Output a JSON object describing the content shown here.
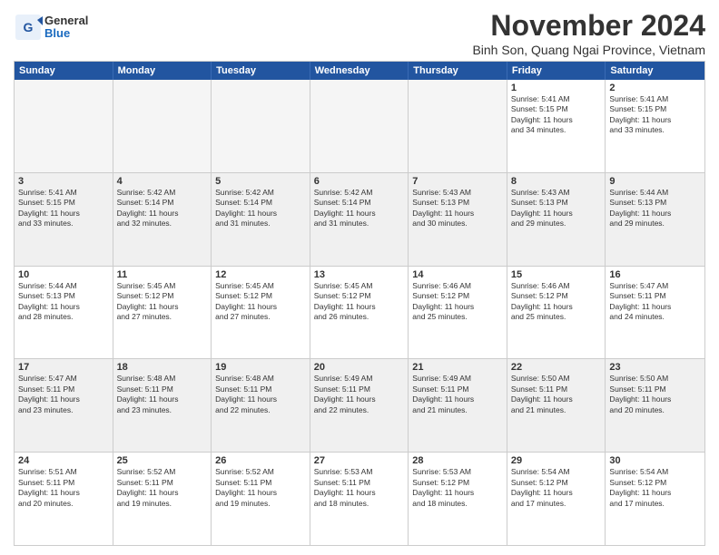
{
  "logo": {
    "general": "General",
    "blue": "Blue"
  },
  "title": "November 2024",
  "location": "Binh Son, Quang Ngai Province, Vietnam",
  "header_days": [
    "Sunday",
    "Monday",
    "Tuesday",
    "Wednesday",
    "Thursday",
    "Friday",
    "Saturday"
  ],
  "weeks": [
    [
      {
        "day": "",
        "info": "",
        "empty": true
      },
      {
        "day": "",
        "info": "",
        "empty": true
      },
      {
        "day": "",
        "info": "",
        "empty": true
      },
      {
        "day": "",
        "info": "",
        "empty": true
      },
      {
        "day": "",
        "info": "",
        "empty": true
      },
      {
        "day": "1",
        "info": "Sunrise: 5:41 AM\nSunset: 5:15 PM\nDaylight: 11 hours\nand 34 minutes.",
        "empty": false
      },
      {
        "day": "2",
        "info": "Sunrise: 5:41 AM\nSunset: 5:15 PM\nDaylight: 11 hours\nand 33 minutes.",
        "empty": false
      }
    ],
    [
      {
        "day": "3",
        "info": "Sunrise: 5:41 AM\nSunset: 5:15 PM\nDaylight: 11 hours\nand 33 minutes.",
        "empty": false
      },
      {
        "day": "4",
        "info": "Sunrise: 5:42 AM\nSunset: 5:14 PM\nDaylight: 11 hours\nand 32 minutes.",
        "empty": false
      },
      {
        "day": "5",
        "info": "Sunrise: 5:42 AM\nSunset: 5:14 PM\nDaylight: 11 hours\nand 31 minutes.",
        "empty": false
      },
      {
        "day": "6",
        "info": "Sunrise: 5:42 AM\nSunset: 5:14 PM\nDaylight: 11 hours\nand 31 minutes.",
        "empty": false
      },
      {
        "day": "7",
        "info": "Sunrise: 5:43 AM\nSunset: 5:13 PM\nDaylight: 11 hours\nand 30 minutes.",
        "empty": false
      },
      {
        "day": "8",
        "info": "Sunrise: 5:43 AM\nSunset: 5:13 PM\nDaylight: 11 hours\nand 29 minutes.",
        "empty": false
      },
      {
        "day": "9",
        "info": "Sunrise: 5:44 AM\nSunset: 5:13 PM\nDaylight: 11 hours\nand 29 minutes.",
        "empty": false
      }
    ],
    [
      {
        "day": "10",
        "info": "Sunrise: 5:44 AM\nSunset: 5:13 PM\nDaylight: 11 hours\nand 28 minutes.",
        "empty": false
      },
      {
        "day": "11",
        "info": "Sunrise: 5:45 AM\nSunset: 5:12 PM\nDaylight: 11 hours\nand 27 minutes.",
        "empty": false
      },
      {
        "day": "12",
        "info": "Sunrise: 5:45 AM\nSunset: 5:12 PM\nDaylight: 11 hours\nand 27 minutes.",
        "empty": false
      },
      {
        "day": "13",
        "info": "Sunrise: 5:45 AM\nSunset: 5:12 PM\nDaylight: 11 hours\nand 26 minutes.",
        "empty": false
      },
      {
        "day": "14",
        "info": "Sunrise: 5:46 AM\nSunset: 5:12 PM\nDaylight: 11 hours\nand 25 minutes.",
        "empty": false
      },
      {
        "day": "15",
        "info": "Sunrise: 5:46 AM\nSunset: 5:12 PM\nDaylight: 11 hours\nand 25 minutes.",
        "empty": false
      },
      {
        "day": "16",
        "info": "Sunrise: 5:47 AM\nSunset: 5:11 PM\nDaylight: 11 hours\nand 24 minutes.",
        "empty": false
      }
    ],
    [
      {
        "day": "17",
        "info": "Sunrise: 5:47 AM\nSunset: 5:11 PM\nDaylight: 11 hours\nand 23 minutes.",
        "empty": false
      },
      {
        "day": "18",
        "info": "Sunrise: 5:48 AM\nSunset: 5:11 PM\nDaylight: 11 hours\nand 23 minutes.",
        "empty": false
      },
      {
        "day": "19",
        "info": "Sunrise: 5:48 AM\nSunset: 5:11 PM\nDaylight: 11 hours\nand 22 minutes.",
        "empty": false
      },
      {
        "day": "20",
        "info": "Sunrise: 5:49 AM\nSunset: 5:11 PM\nDaylight: 11 hours\nand 22 minutes.",
        "empty": false
      },
      {
        "day": "21",
        "info": "Sunrise: 5:49 AM\nSunset: 5:11 PM\nDaylight: 11 hours\nand 21 minutes.",
        "empty": false
      },
      {
        "day": "22",
        "info": "Sunrise: 5:50 AM\nSunset: 5:11 PM\nDaylight: 11 hours\nand 21 minutes.",
        "empty": false
      },
      {
        "day": "23",
        "info": "Sunrise: 5:50 AM\nSunset: 5:11 PM\nDaylight: 11 hours\nand 20 minutes.",
        "empty": false
      }
    ],
    [
      {
        "day": "24",
        "info": "Sunrise: 5:51 AM\nSunset: 5:11 PM\nDaylight: 11 hours\nand 20 minutes.",
        "empty": false
      },
      {
        "day": "25",
        "info": "Sunrise: 5:52 AM\nSunset: 5:11 PM\nDaylight: 11 hours\nand 19 minutes.",
        "empty": false
      },
      {
        "day": "26",
        "info": "Sunrise: 5:52 AM\nSunset: 5:11 PM\nDaylight: 11 hours\nand 19 minutes.",
        "empty": false
      },
      {
        "day": "27",
        "info": "Sunrise: 5:53 AM\nSunset: 5:11 PM\nDaylight: 11 hours\nand 18 minutes.",
        "empty": false
      },
      {
        "day": "28",
        "info": "Sunrise: 5:53 AM\nSunset: 5:12 PM\nDaylight: 11 hours\nand 18 minutes.",
        "empty": false
      },
      {
        "day": "29",
        "info": "Sunrise: 5:54 AM\nSunset: 5:12 PM\nDaylight: 11 hours\nand 17 minutes.",
        "empty": false
      },
      {
        "day": "30",
        "info": "Sunrise: 5:54 AM\nSunset: 5:12 PM\nDaylight: 11 hours\nand 17 minutes.",
        "empty": false
      }
    ]
  ]
}
